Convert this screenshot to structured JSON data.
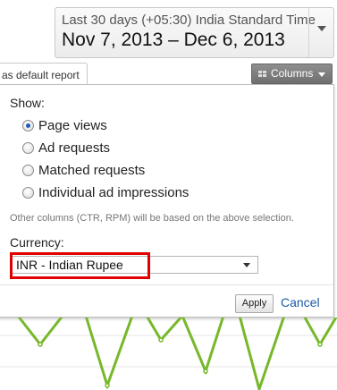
{
  "date_range": {
    "timezone_label": "Last 30 days (+05:30) India Standard Time",
    "range_label": "Nov 7, 2013 – Dec 6, 2013"
  },
  "report_tab": {
    "label": "as default report"
  },
  "columns_button": {
    "label": "Columns"
  },
  "panel": {
    "show_heading": "Show:",
    "options": [
      {
        "label": "Page views",
        "checked": true
      },
      {
        "label": "Ad requests",
        "checked": false
      },
      {
        "label": "Matched requests",
        "checked": false
      },
      {
        "label": "Individual ad impressions",
        "checked": false
      }
    ],
    "note": "Other columns (CTR, RPM) will be based on the above selection.",
    "currency_heading": "Currency:",
    "currency_value": "INR - Indian Rupee",
    "apply_label": "Apply",
    "cancel_label": "Cancel"
  },
  "colors": {
    "chart_line": "#77b82a",
    "highlight": "#e00000",
    "link": "#1a5aa8"
  }
}
